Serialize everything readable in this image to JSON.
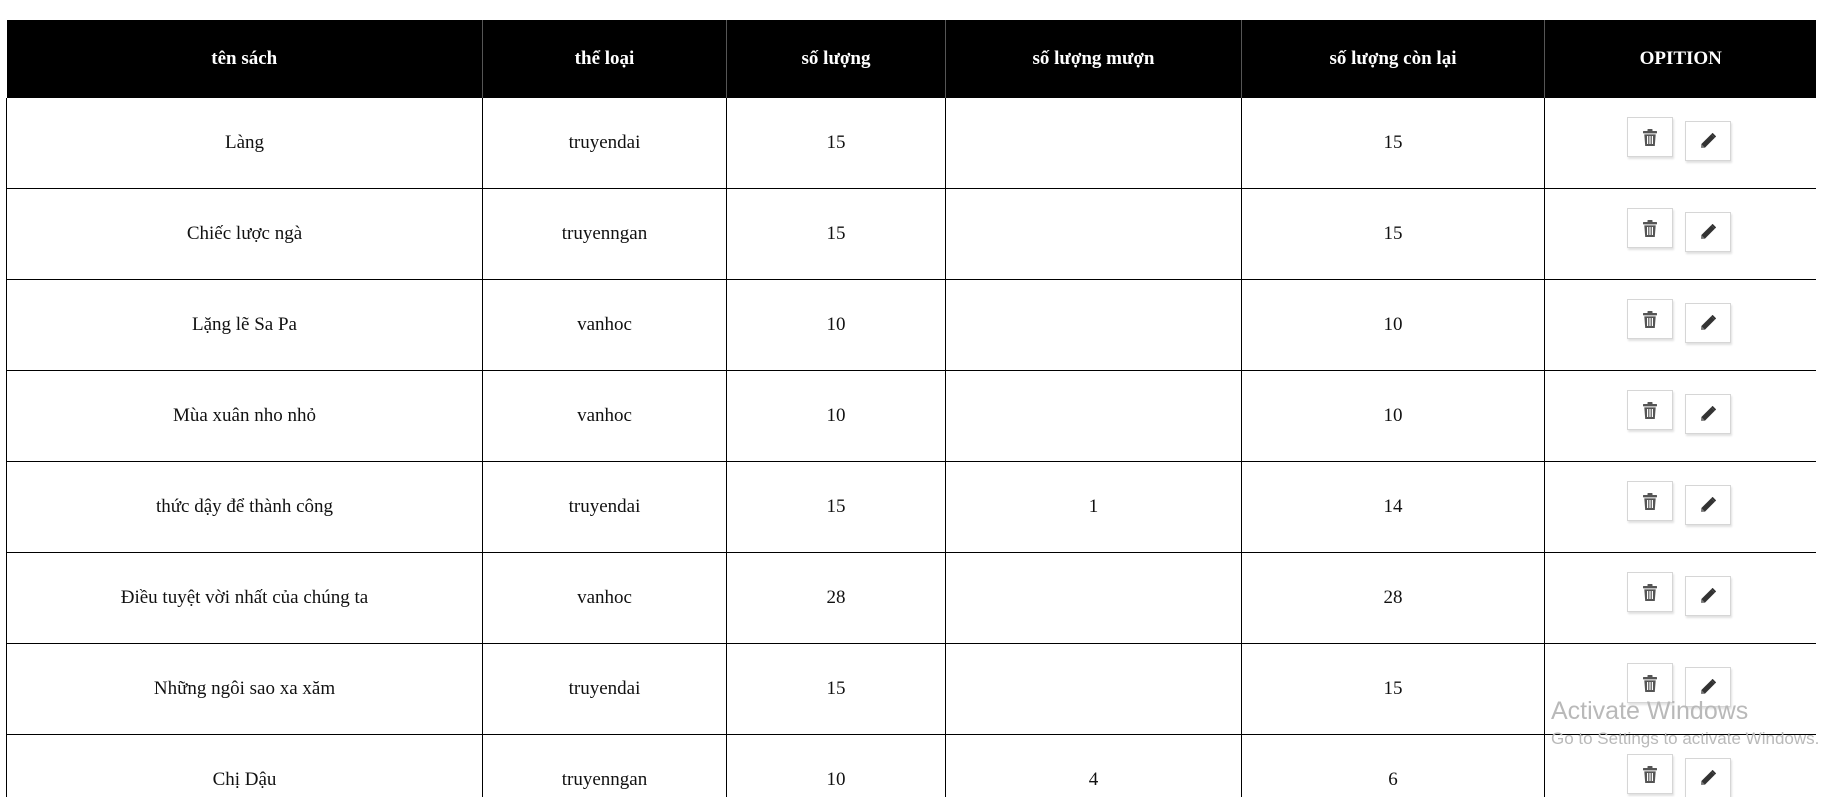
{
  "table": {
    "headers": [
      "tên sách",
      "thể loại",
      "số lượng",
      "số lượng mượn",
      "số lượng còn lại",
      "OPITION"
    ],
    "rows": [
      {
        "name": "Làng",
        "category": "truyendai",
        "quantity": "15",
        "borrowed": "",
        "remaining": "15"
      },
      {
        "name": "Chiếc lược ngà",
        "category": "truyenngan",
        "quantity": "15",
        "borrowed": "",
        "remaining": "15"
      },
      {
        "name": "Lặng lẽ Sa Pa",
        "category": "vanhoc",
        "quantity": "10",
        "borrowed": "",
        "remaining": "10"
      },
      {
        "name": "Mùa xuân nho nhỏ",
        "category": "vanhoc",
        "quantity": "10",
        "borrowed": "",
        "remaining": "10"
      },
      {
        "name": "thức dậy để thành công",
        "category": "truyendai",
        "quantity": "15",
        "borrowed": "1",
        "remaining": "14"
      },
      {
        "name": "Điều tuyệt vời nhất của chúng ta",
        "category": "vanhoc",
        "quantity": "28",
        "borrowed": "",
        "remaining": "28"
      },
      {
        "name": "Những ngôi sao xa xăm",
        "category": "truyendai",
        "quantity": "15",
        "borrowed": "",
        "remaining": "15"
      },
      {
        "name": "Chị Dậu",
        "category": "truyenngan",
        "quantity": "10",
        "borrowed": "4",
        "remaining": "6"
      }
    ],
    "row_actions": {
      "delete_icon": "trash-icon",
      "edit_icon": "pencil-icon"
    }
  },
  "watermark": {
    "title": "Activate Windows",
    "subtitle": "Go to Settings to activate Windows."
  },
  "colors": {
    "header_bg": "#000000",
    "header_text": "#ffffff",
    "grid": "#000000",
    "icon": "#555555"
  }
}
